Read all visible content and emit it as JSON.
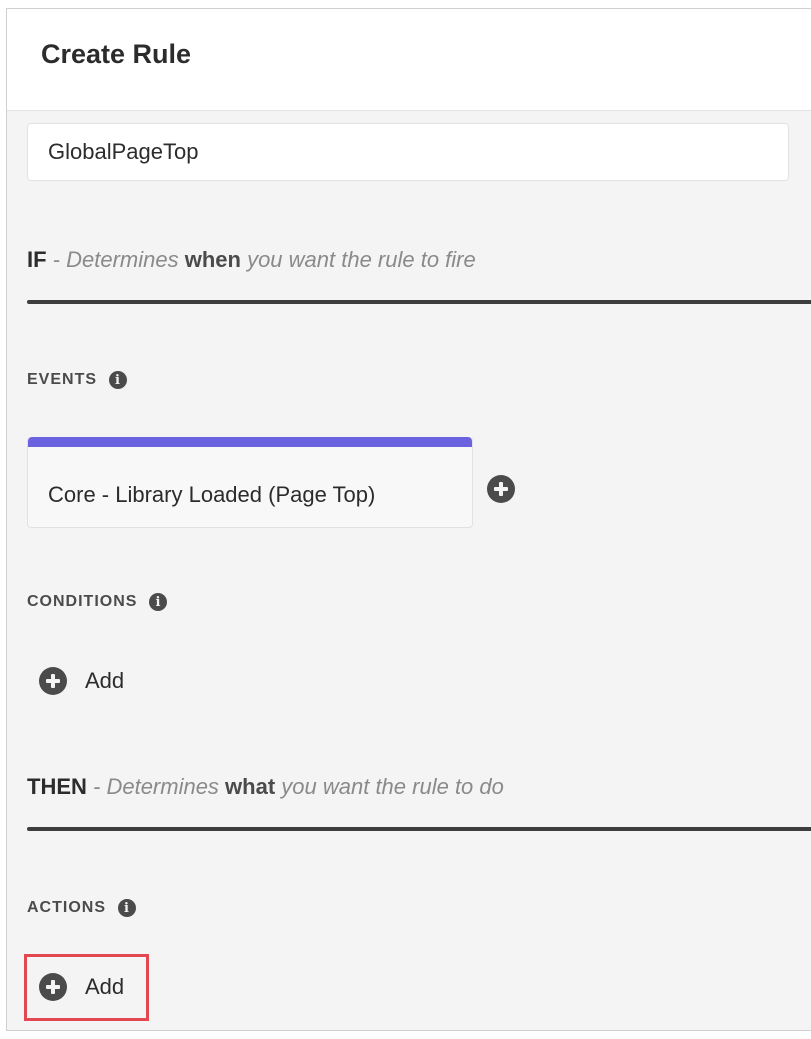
{
  "header": {
    "title": "Create Rule"
  },
  "rule_name": {
    "value": "GlobalPageTop"
  },
  "if_section": {
    "keyword": "IF",
    "sep": " - ",
    "text_a": "Determines",
    "text_b": " when ",
    "text_c": "you want the rule to fire"
  },
  "events": {
    "heading": "EVENTS",
    "items": [
      {
        "label": "Core - Library Loaded (Page Top)"
      }
    ],
    "accent_color": "#6b62e0"
  },
  "conditions": {
    "heading": "CONDITIONS",
    "add_label": "Add"
  },
  "then_section": {
    "keyword": "THEN",
    "sep": " - ",
    "text_a": "Determines",
    "text_b": " what ",
    "text_c": "you want the rule to do"
  },
  "actions": {
    "heading": "ACTIONS",
    "add_label": "Add"
  },
  "colors": {
    "highlight": "#e34850",
    "panel_bg": "#f4f4f4",
    "rule_line": "#3d3d3d"
  }
}
